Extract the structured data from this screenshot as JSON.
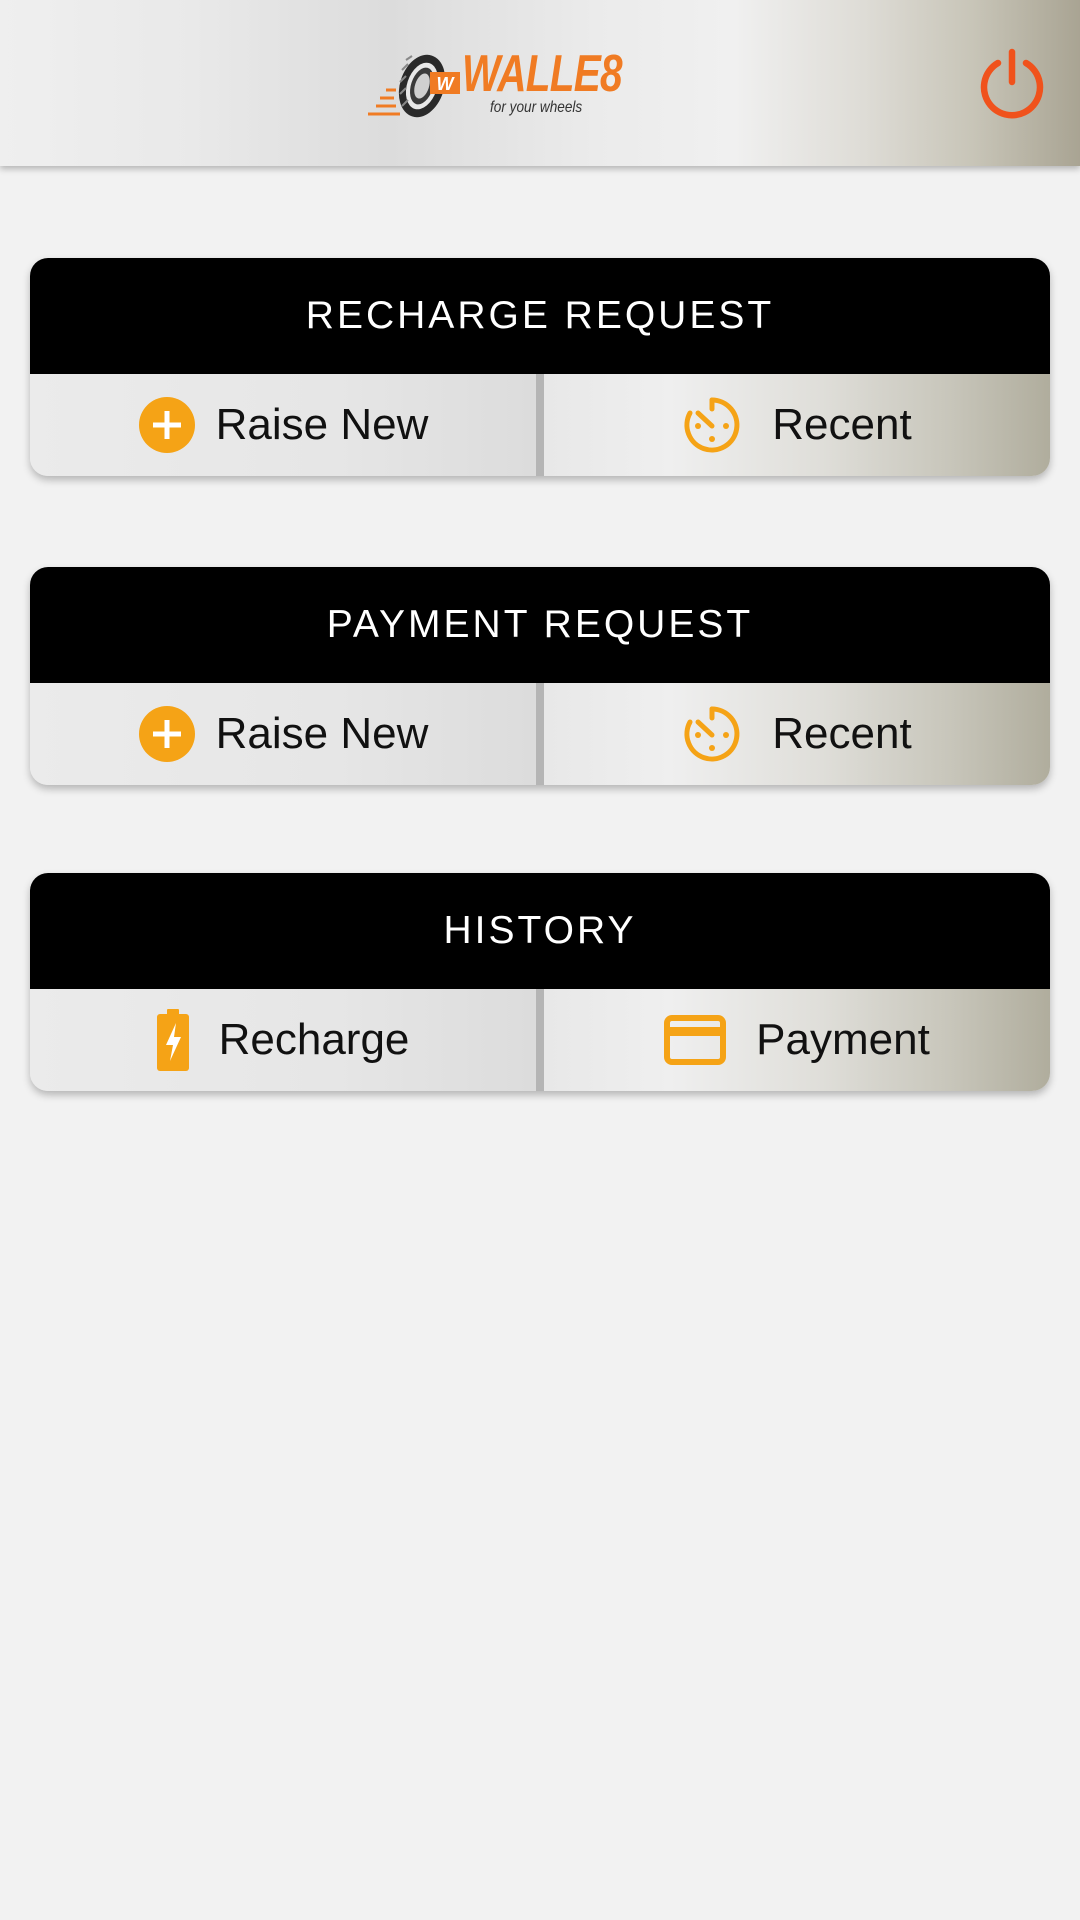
{
  "app": {
    "brand_name": "WALLE8",
    "brand_tagline": "for your wheels",
    "logo_letter": "W",
    "power_icon": "power-icon"
  },
  "colors": {
    "accent_orange": "#F5A316",
    "power_red": "#F0521C",
    "brand_orange": "#F07B23",
    "header_black": "#000000"
  },
  "cards": [
    {
      "title": "RECHARGE REQUEST",
      "actions": [
        {
          "label": "Raise New",
          "icon": "add-circle-icon"
        },
        {
          "label": "Recent",
          "icon": "history-timer-icon"
        }
      ]
    },
    {
      "title": "PAYMENT REQUEST",
      "actions": [
        {
          "label": "Raise New",
          "icon": "add-circle-icon"
        },
        {
          "label": "Recent",
          "icon": "history-timer-icon"
        }
      ]
    },
    {
      "title": "HISTORY",
      "actions": [
        {
          "label": "Recharge",
          "icon": "battery-charging-icon"
        },
        {
          "label": "Payment",
          "icon": "credit-card-icon"
        }
      ]
    }
  ]
}
